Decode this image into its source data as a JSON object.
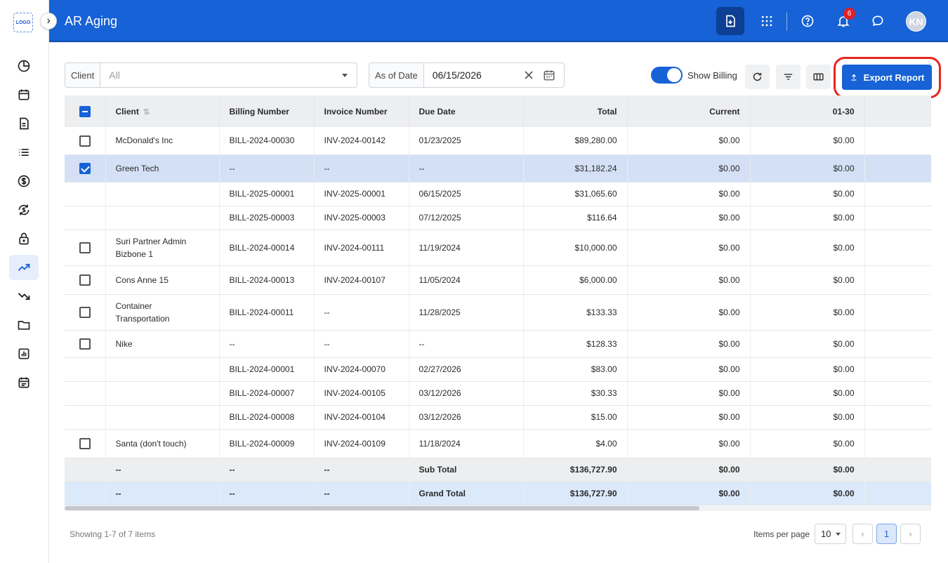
{
  "app": {
    "logo_text": "LOGO",
    "title": "AR Aging"
  },
  "header": {
    "notification_count": "6",
    "avatar_initials": "KN"
  },
  "filters": {
    "client_label": "Client",
    "client_value": "All",
    "date_label": "As of Date",
    "date_value": "06/15/2026",
    "show_billing_label": "Show Billing",
    "show_billing_on": true,
    "export_label": "Export Report"
  },
  "table": {
    "columns": [
      "Client",
      "Billing Number",
      "Invoice Number",
      "Due Date",
      "Total",
      "Current",
      "01-30"
    ],
    "rows": [
      {
        "client": "McDonald's Inc",
        "billing": "BILL-2024-00030",
        "invoice": "INV-2024-00142",
        "due": "01/23/2025",
        "total": "$89,280.00",
        "current": "$0.00",
        "d0130": "$0.00"
      },
      {
        "client": "Green Tech",
        "billing": "--",
        "invoice": "--",
        "due": "--",
        "total": "$31,182.24",
        "current": "$0.00",
        "d0130": "$0.00"
      },
      {
        "client": "",
        "billing": "BILL-2025-00001",
        "invoice": "INV-2025-00001",
        "due": "06/15/2025",
        "total": "$31,065.60",
        "current": "$0.00",
        "d0130": "$0.00"
      },
      {
        "client": "",
        "billing": "BILL-2025-00003",
        "invoice": "INV-2025-00003",
        "due": "07/12/2025",
        "total": "$116.64",
        "current": "$0.00",
        "d0130": "$0.00"
      },
      {
        "client_line1": "Suri Partner Admin",
        "client_line2": "Bizbone 1",
        "billing": "BILL-2024-00014",
        "invoice": "INV-2024-00111",
        "due": "11/19/2024",
        "total": "$10,000.00",
        "current": "$0.00",
        "d0130": "$0.00"
      },
      {
        "client": "Cons Anne 15",
        "billing": "BILL-2024-00013",
        "invoice": "INV-2024-00107",
        "due": "11/05/2024",
        "total": "$6,000.00",
        "current": "$0.00",
        "d0130": "$0.00"
      },
      {
        "client_line1": "Container",
        "client_line2": "Transportation",
        "billing": "BILL-2024-00011",
        "invoice": "--",
        "due": "11/28/2025",
        "total": "$133.33",
        "current": "$0.00",
        "d0130": "$0.00"
      },
      {
        "client": "Nike",
        "billing": "--",
        "invoice": "--",
        "due": "--",
        "total": "$128.33",
        "current": "$0.00",
        "d0130": "$0.00"
      },
      {
        "client": "",
        "billing": "BILL-2024-00001",
        "invoice": "INV-2024-00070",
        "due": "02/27/2026",
        "total": "$83.00",
        "current": "$0.00",
        "d0130": "$0.00"
      },
      {
        "client": "",
        "billing": "BILL-2024-00007",
        "invoice": "INV-2024-00105",
        "due": "03/12/2026",
        "total": "$30.33",
        "current": "$0.00",
        "d0130": "$0.00"
      },
      {
        "client": "",
        "billing": "BILL-2024-00008",
        "invoice": "INV-2024-00104",
        "due": "03/12/2026",
        "total": "$15.00",
        "current": "$0.00",
        "d0130": "$0.00"
      },
      {
        "client": "Santa (don't touch)",
        "billing": "BILL-2024-00009",
        "invoice": "INV-2024-00109",
        "due": "11/18/2024",
        "total": "$4.00",
        "current": "$0.00",
        "d0130": "$0.00"
      }
    ],
    "subtotal": {
      "client": "--",
      "billing": "--",
      "invoice": "--",
      "label": "Sub Total",
      "total": "$136,727.90",
      "current": "$0.00",
      "d0130": "$0.00"
    },
    "grandtotal": {
      "client": "--",
      "billing": "--",
      "invoice": "--",
      "label": "Grand Total",
      "total": "$136,727.90",
      "current": "$0.00",
      "d0130": "$0.00"
    }
  },
  "footer": {
    "showing": "Showing 1-7 of 7 items",
    "items_per_page_label": "Items per page",
    "items_per_page_value": "10",
    "current_page": "1",
    "prev_symbol": "‹",
    "next_symbol": "›"
  },
  "colors": {
    "brand": "#1662d6",
    "highlight_ring": "#e8251e",
    "selected_row": "#d3e0f5"
  }
}
